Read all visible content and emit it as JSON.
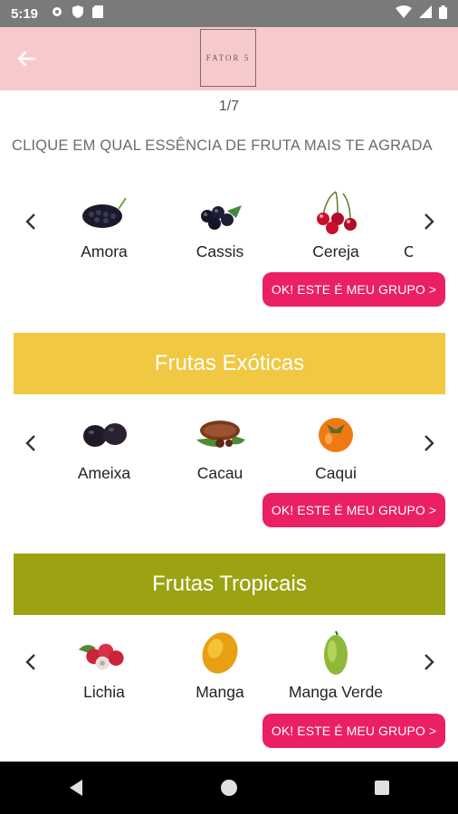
{
  "status_bar": {
    "time": "5:19"
  },
  "app_bar": {
    "logo_text": "FATOR 5"
  },
  "pager": "1/7",
  "question": "CLIQUE EM QUAL ESSÊNCIA DE FRUTA MAIS TE AGRADA",
  "groups": [
    {
      "items": [
        "Amora",
        "Cassis",
        "Cereja"
      ],
      "partial_next": "C",
      "button": "OK! ESTE É MEU GRUPO >"
    },
    {
      "banner": "Frutas Exóticas",
      "banner_color": "#f0c842",
      "items": [
        "Ameixa",
        "Cacau",
        "Caqui"
      ],
      "button": "OK! ESTE É MEU GRUPO >"
    },
    {
      "banner": "Frutas Tropicais",
      "banner_color": "#9ca312",
      "items": [
        "Lichia",
        "Manga",
        "Manga Verde"
      ],
      "button": "OK! ESTE É MEU GRUPO >"
    }
  ],
  "colors": {
    "app_bar": "#f8c9cc",
    "accent_button": "#ea1f66",
    "status_bar": "#7a7a7a",
    "nav_bar": "#000000"
  },
  "icons": {
    "status": [
      "gear-icon",
      "shield-icon",
      "sd-card-icon",
      "wifi-icon",
      "signal-icon",
      "battery-icon"
    ],
    "nav": [
      "back-triangle-icon",
      "home-circle-icon",
      "recents-square-icon"
    ]
  }
}
